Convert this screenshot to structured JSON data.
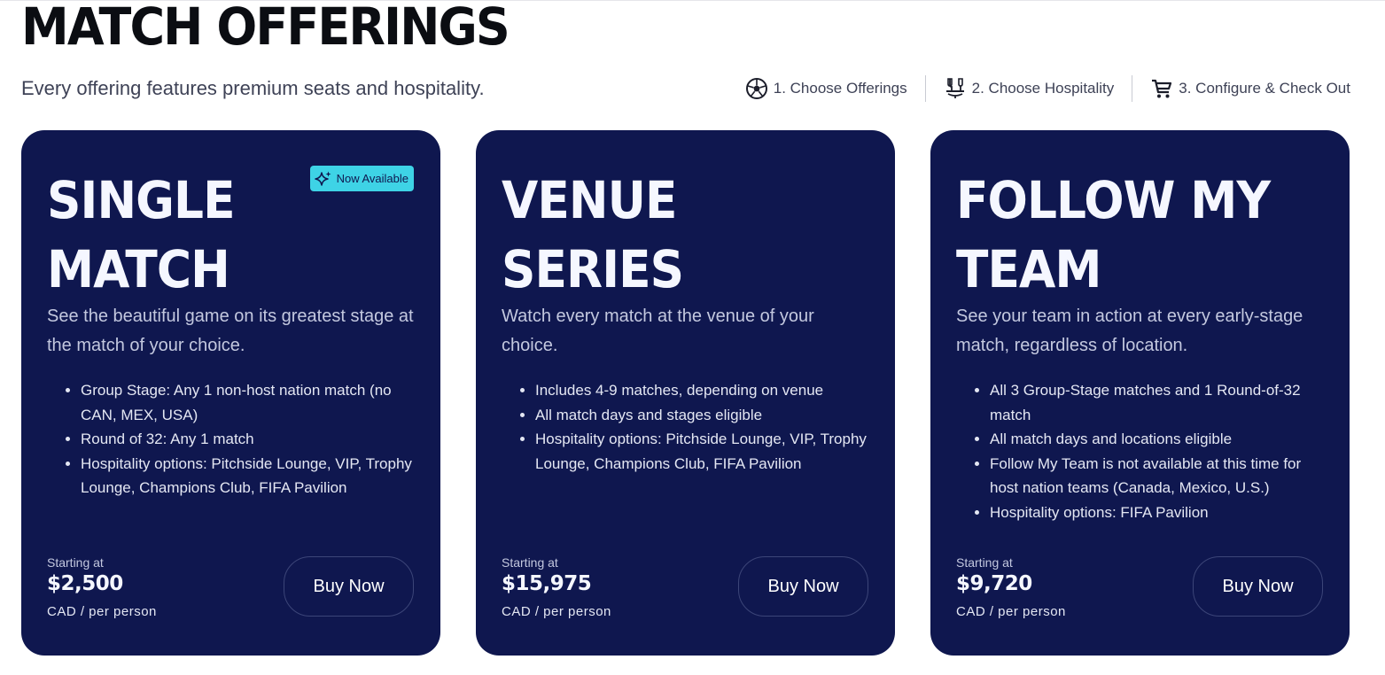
{
  "header": {
    "title": "MATCH OFFERINGS",
    "subtitle": "Every offering features premium seats and hospitality."
  },
  "steps": [
    {
      "label": "1. Choose Offerings",
      "icon": "soccer-ball-icon"
    },
    {
      "label": "2. Choose Hospitality",
      "icon": "hospitality-icon"
    },
    {
      "label": "3. Configure & Check Out",
      "icon": "cart-icon"
    }
  ],
  "cards": [
    {
      "title": "SINGLE MATCH",
      "badge": "Now Available",
      "description": "See the beautiful game on its greatest stage at the match of your choice.",
      "features": [
        "Group Stage: Any 1 non-host nation match (no CAN, MEX, USA)",
        "Round of 32: Any 1 match",
        "Hospitality options: Pitchside Lounge, VIP, Trophy Lounge, Champions Club, FIFA Pavilion"
      ],
      "price_label": "Starting at",
      "price": "$2,500",
      "price_unit": "CAD / per person",
      "button": "Buy Now"
    },
    {
      "title": "VENUE SERIES",
      "description": "Watch every match at the venue of your choice.",
      "features": [
        "Includes 4-9 matches, depending on venue",
        "All match days and stages eligible",
        "Hospitality options: Pitchside Lounge, VIP, Trophy Lounge, Champions Club, FIFA Pavilion"
      ],
      "price_label": "Starting at",
      "price": "$15,975",
      "price_unit": "CAD / per person",
      "button": "Buy Now"
    },
    {
      "title": "FOLLOW MY TEAM",
      "description": "See your team in action at every early-stage match, regardless of location.",
      "features": [
        "All 3 Group-Stage matches and 1 Round-of-32 match",
        "All match days and locations eligible",
        "Follow My Team is not available at this time for host nation teams (Canada, Mexico, U.S.)",
        "Hospitality options: FIFA Pavilion"
      ],
      "price_label": "Starting at",
      "price": "$9,720",
      "price_unit": "CAD / per person",
      "button": "Buy Now"
    }
  ],
  "colors": {
    "card_bg": "#0f174f",
    "badge_bg": "#3ed3e6",
    "title_text": "#0b0d12"
  }
}
